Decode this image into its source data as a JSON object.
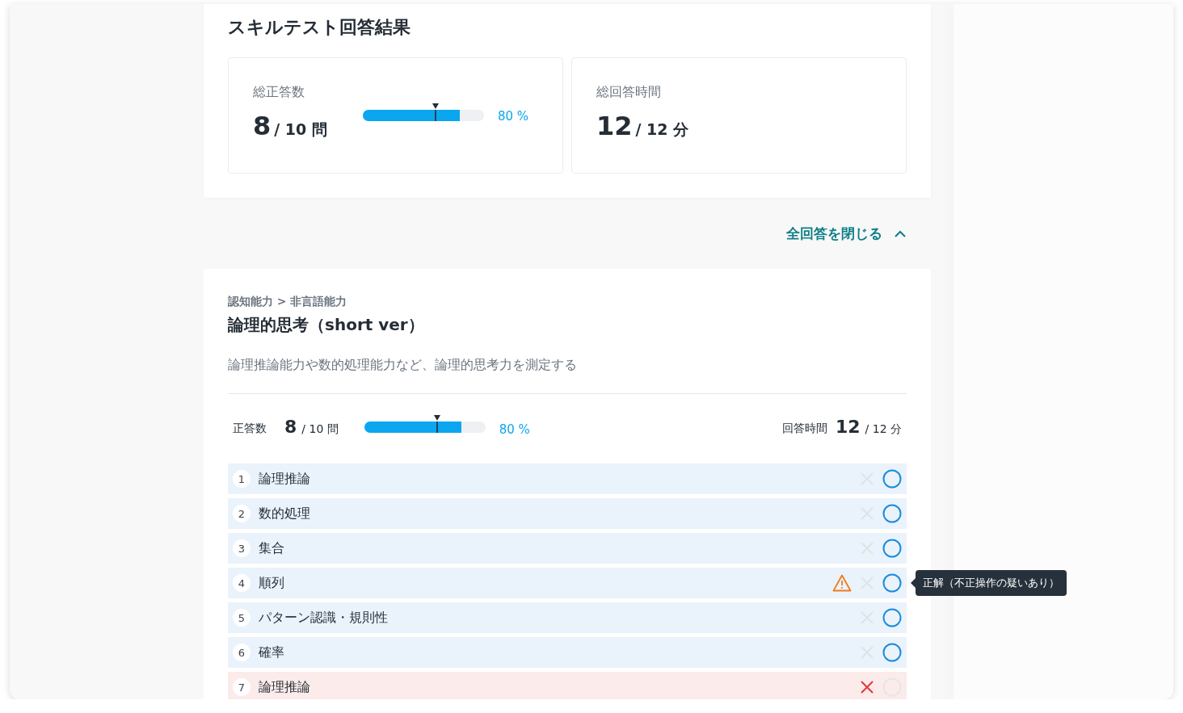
{
  "page_title": "スキルテスト回答結果",
  "summary": {
    "score": {
      "label": "総正答数",
      "value": "8",
      "unit": "/ 10 問",
      "meter": {
        "level": 0.8,
        "average": {
          "level": 0.6
        }
      },
      "percent": "80 %"
    },
    "time": {
      "label": "総回答時間",
      "value": "12",
      "unit": "/ 12 分"
    }
  },
  "toggle": {
    "label": "全回答を閉じる",
    "expanded": true
  },
  "section": {
    "breadcrumb": "認知能力 > 非言語能力",
    "title": "論理的思考（short ver）",
    "description": "論理推論能力や数的処理能力など、論理的思考力を測定する",
    "score": {
      "label": "正答数",
      "value": "8",
      "unit": "/ 10 問",
      "meter": {
        "level": 0.8,
        "average": {
          "level": 0.6
        }
      },
      "percent": "80 %"
    },
    "time": {
      "label": "回答時間",
      "value": "12",
      "unit": "/ 12 分"
    },
    "questions": [
      {
        "number": "1",
        "name": "論理推論",
        "correct": true,
        "warning": false
      },
      {
        "number": "2",
        "name": "数的処理",
        "correct": true,
        "warning": false
      },
      {
        "number": "3",
        "name": "集合",
        "correct": true,
        "warning": false
      },
      {
        "number": "4",
        "name": "順列",
        "correct": true,
        "warning": true,
        "tooltip": "正解（不正操作の疑いあり）"
      },
      {
        "number": "5",
        "name": "パターン認識・規則性",
        "correct": true,
        "warning": false
      },
      {
        "number": "6",
        "name": "確率",
        "correct": true,
        "warning": false
      },
      {
        "number": "7",
        "name": "論理推論",
        "correct": false,
        "warning": false
      }
    ]
  }
}
